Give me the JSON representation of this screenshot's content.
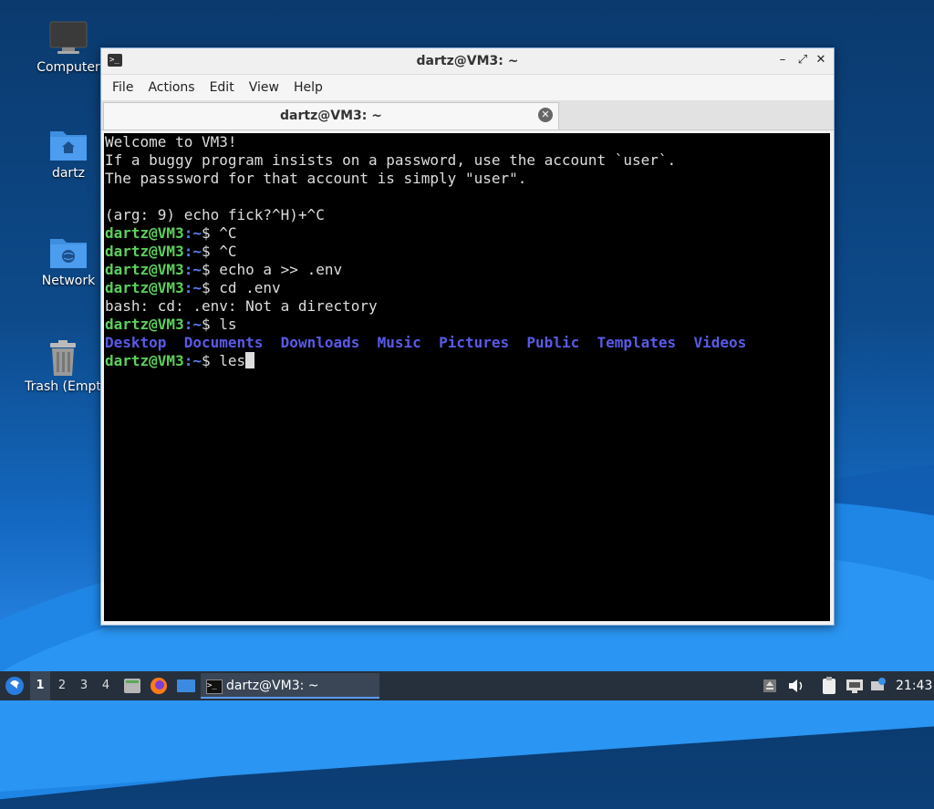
{
  "desktop": {
    "icons": [
      {
        "label": "Computer"
      },
      {
        "label": "dartz"
      },
      {
        "label": "Network"
      },
      {
        "label": "Trash (Empt"
      }
    ]
  },
  "window": {
    "title": "dartz@VM3: ~",
    "controls": {
      "minimize": "–",
      "maximize": "⤢",
      "close": "✕"
    },
    "menu": [
      "File",
      "Actions",
      "Edit",
      "View",
      "Help"
    ],
    "tab": {
      "title": "dartz@VM3: ~",
      "close": "✕"
    }
  },
  "terminal": {
    "prompt_user": "dartz@VM3",
    "prompt_path": ":~",
    "prompt_symbol": "$ ",
    "lines": [
      {
        "type": "text",
        "text": "Welcome to VM3!"
      },
      {
        "type": "text",
        "text": "If a buggy program insists on a password, use the account `user`."
      },
      {
        "type": "text",
        "text": "The passsword for that account is simply \"user\"."
      },
      {
        "type": "text",
        "text": ""
      },
      {
        "type": "text",
        "text": "(arg: 9) echo fick?^H)+^C"
      },
      {
        "type": "prompt",
        "cmd": "^C"
      },
      {
        "type": "prompt",
        "cmd": "^C"
      },
      {
        "type": "prompt",
        "cmd": "echo a >> .env"
      },
      {
        "type": "prompt",
        "cmd": "cd .env"
      },
      {
        "type": "text",
        "text": "bash: cd: .env: Not a directory"
      },
      {
        "type": "prompt",
        "cmd": "ls"
      },
      {
        "type": "dirs",
        "items": [
          "Desktop",
          "Documents",
          "Downloads",
          "Music",
          "Pictures",
          "Public",
          "Templates",
          "Videos"
        ]
      },
      {
        "type": "prompt",
        "cmd": "les",
        "cursor": true
      }
    ]
  },
  "taskbar": {
    "workspaces": [
      "1",
      "2",
      "3",
      "4"
    ],
    "active_workspace": "1",
    "task_label": "dartz@VM3: ~",
    "clock": "21:43"
  },
  "colors": {
    "prompt_user": "#5cd05c",
    "prompt_path": "#5a7ef0",
    "directory": "#5a5ae8",
    "terminal_bg": "#000000",
    "taskbar_bg": "#26303c"
  }
}
